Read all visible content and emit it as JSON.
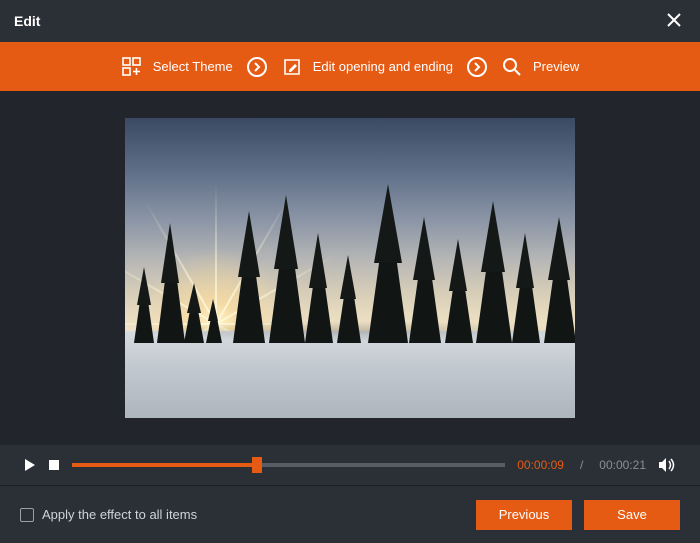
{
  "window": {
    "title": "Edit"
  },
  "steps": {
    "theme": "Select Theme",
    "opening": "Edit opening and ending",
    "preview": "Preview"
  },
  "playback": {
    "current": "00:00:09",
    "duration": "00:00:21",
    "progress_pct": 42.8
  },
  "footer": {
    "apply_all": "Apply the effect to all items",
    "previous": "Previous",
    "save": "Save"
  },
  "colors": {
    "accent": "#e65b14",
    "bg": "#2b2f36"
  }
}
